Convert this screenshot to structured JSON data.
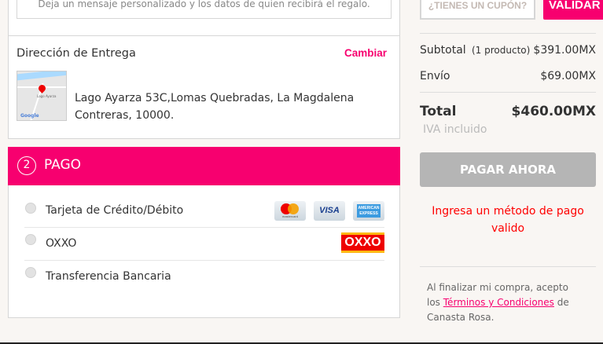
{
  "gift": {
    "message_placeholder": "Deja un mensaje personalizado y los datos de quien recibirá el regalo."
  },
  "delivery": {
    "title": "Dirección de Entrega",
    "change_label": "Cambiar",
    "address_line1": "Lago Ayarza 53C,Lomas Quebradas, La Magdalena",
    "address_line2": "Contreras, 10000.",
    "map_label": "Lago Ayarza",
    "map_brand": "Google"
  },
  "payment": {
    "step": "2",
    "title": "PAGO",
    "options": [
      {
        "label": "Tarjeta de Crédito/Débito"
      },
      {
        "label": "OXXO"
      },
      {
        "label": "Transferencia Bancaria"
      }
    ],
    "card_logos": [
      "mastercard",
      "VISA",
      "AMERICAN EXPRESS"
    ],
    "oxxo_logo": "OXXO"
  },
  "summary": {
    "coupon_placeholder": "¿TIENES UN CUPÓN?",
    "validate_label": "VALIDAR",
    "subtotal_label": "Subtotal",
    "subtotal_count": "(1 producto)",
    "subtotal_value": "$391.00MX",
    "shipping_label": "Envío",
    "shipping_value": "$69.00MX",
    "total_label": "Total",
    "total_value": "$460.00MX",
    "tax_note": "IVA incluido",
    "pay_label": "PAGAR AHORA",
    "error": "Ingresa un método de pago valido",
    "terms_pre": "Al finalizar mi compra, acepto los",
    "terms_link": "Términos y Condiciones",
    "terms_post": "de Canasta Rosa."
  },
  "colors": {
    "accent": "#f7006f",
    "error": "#ff0000",
    "disabled": "#b5b5b5"
  }
}
